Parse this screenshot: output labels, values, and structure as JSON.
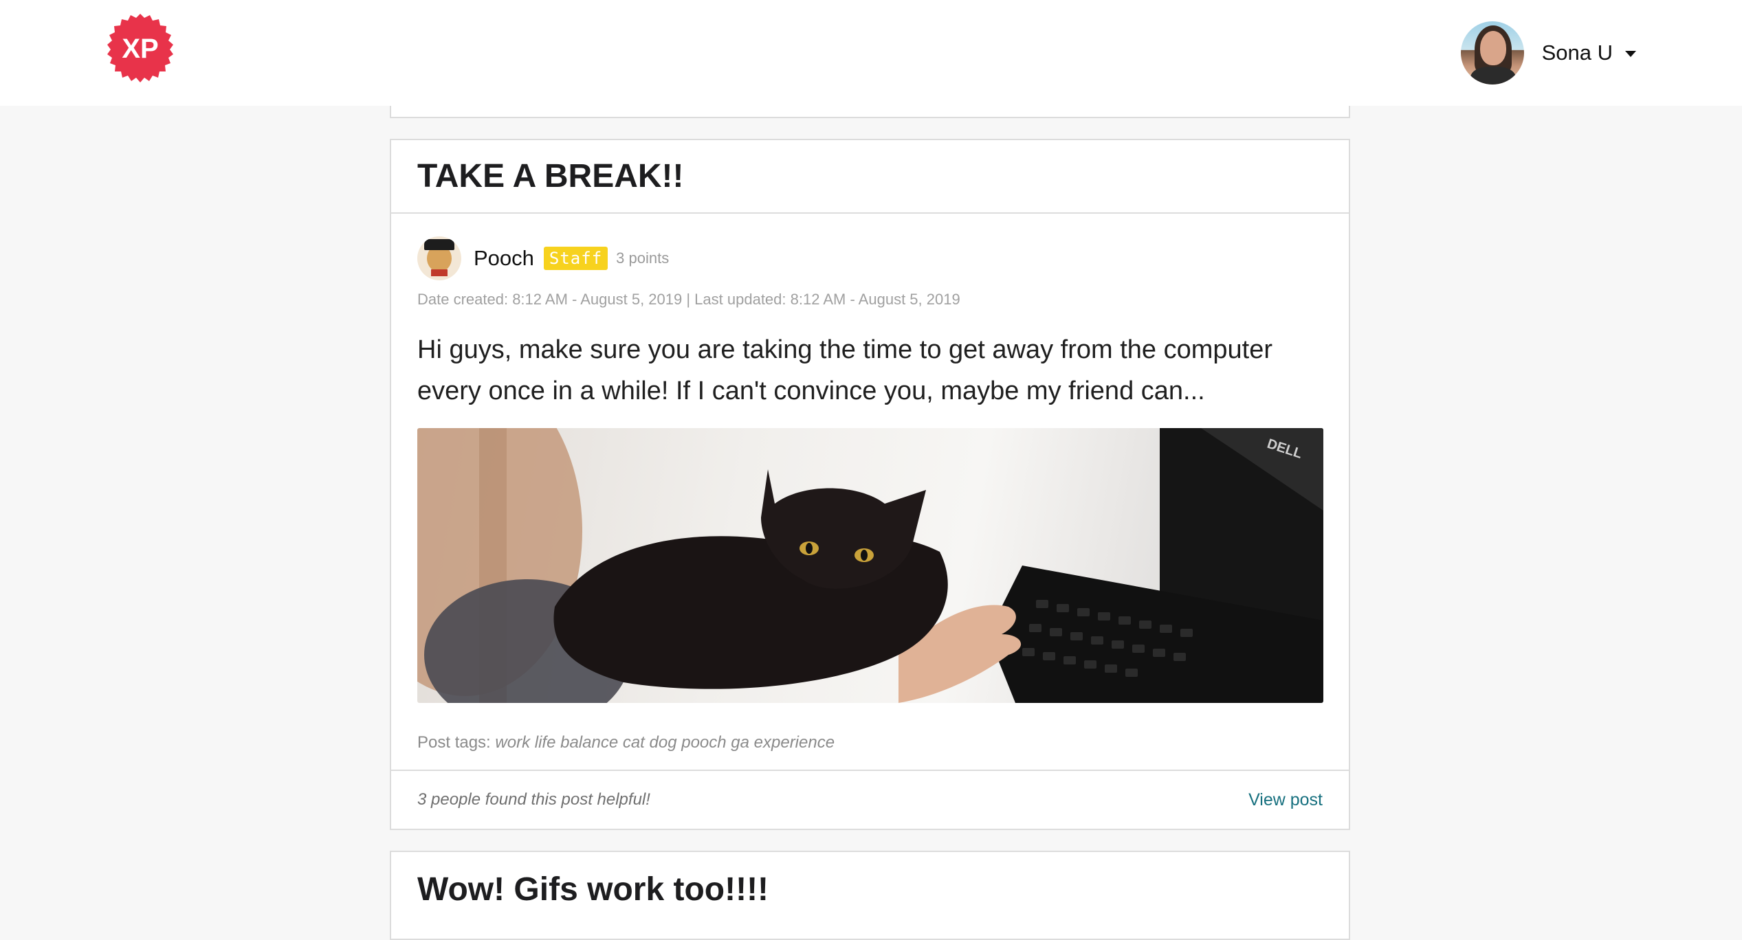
{
  "header": {
    "logo_text": "XP",
    "user_name": "Sona U"
  },
  "post": {
    "title": "TAKE A BREAK!!",
    "author": "Pooch",
    "badge": "Staff",
    "points": "3 points",
    "dates": "Date created: 8:12 AM - August 5, 2019 | Last updated: 8:12 AM - August 5, 2019",
    "body": "Hi guys, make sure you are taking the time to get away from the computer every once in a while! If I can't convince you, maybe my friend can...",
    "tags_label": "Post tags:",
    "tags": "work life balance cat dog pooch ga experience",
    "helpful": "3 people found this post helpful!",
    "view_label": "View post",
    "image_label": "DELL"
  },
  "next_post": {
    "title": "Wow! Gifs work too!!!!"
  },
  "colors": {
    "logo": "#e8334a",
    "staff_badge": "#f7d21e",
    "link": "#17707f",
    "background": "#f7f7f7"
  },
  "icons": {
    "logo": "xp-badge-logo",
    "dropdown": "caret-down-icon"
  }
}
